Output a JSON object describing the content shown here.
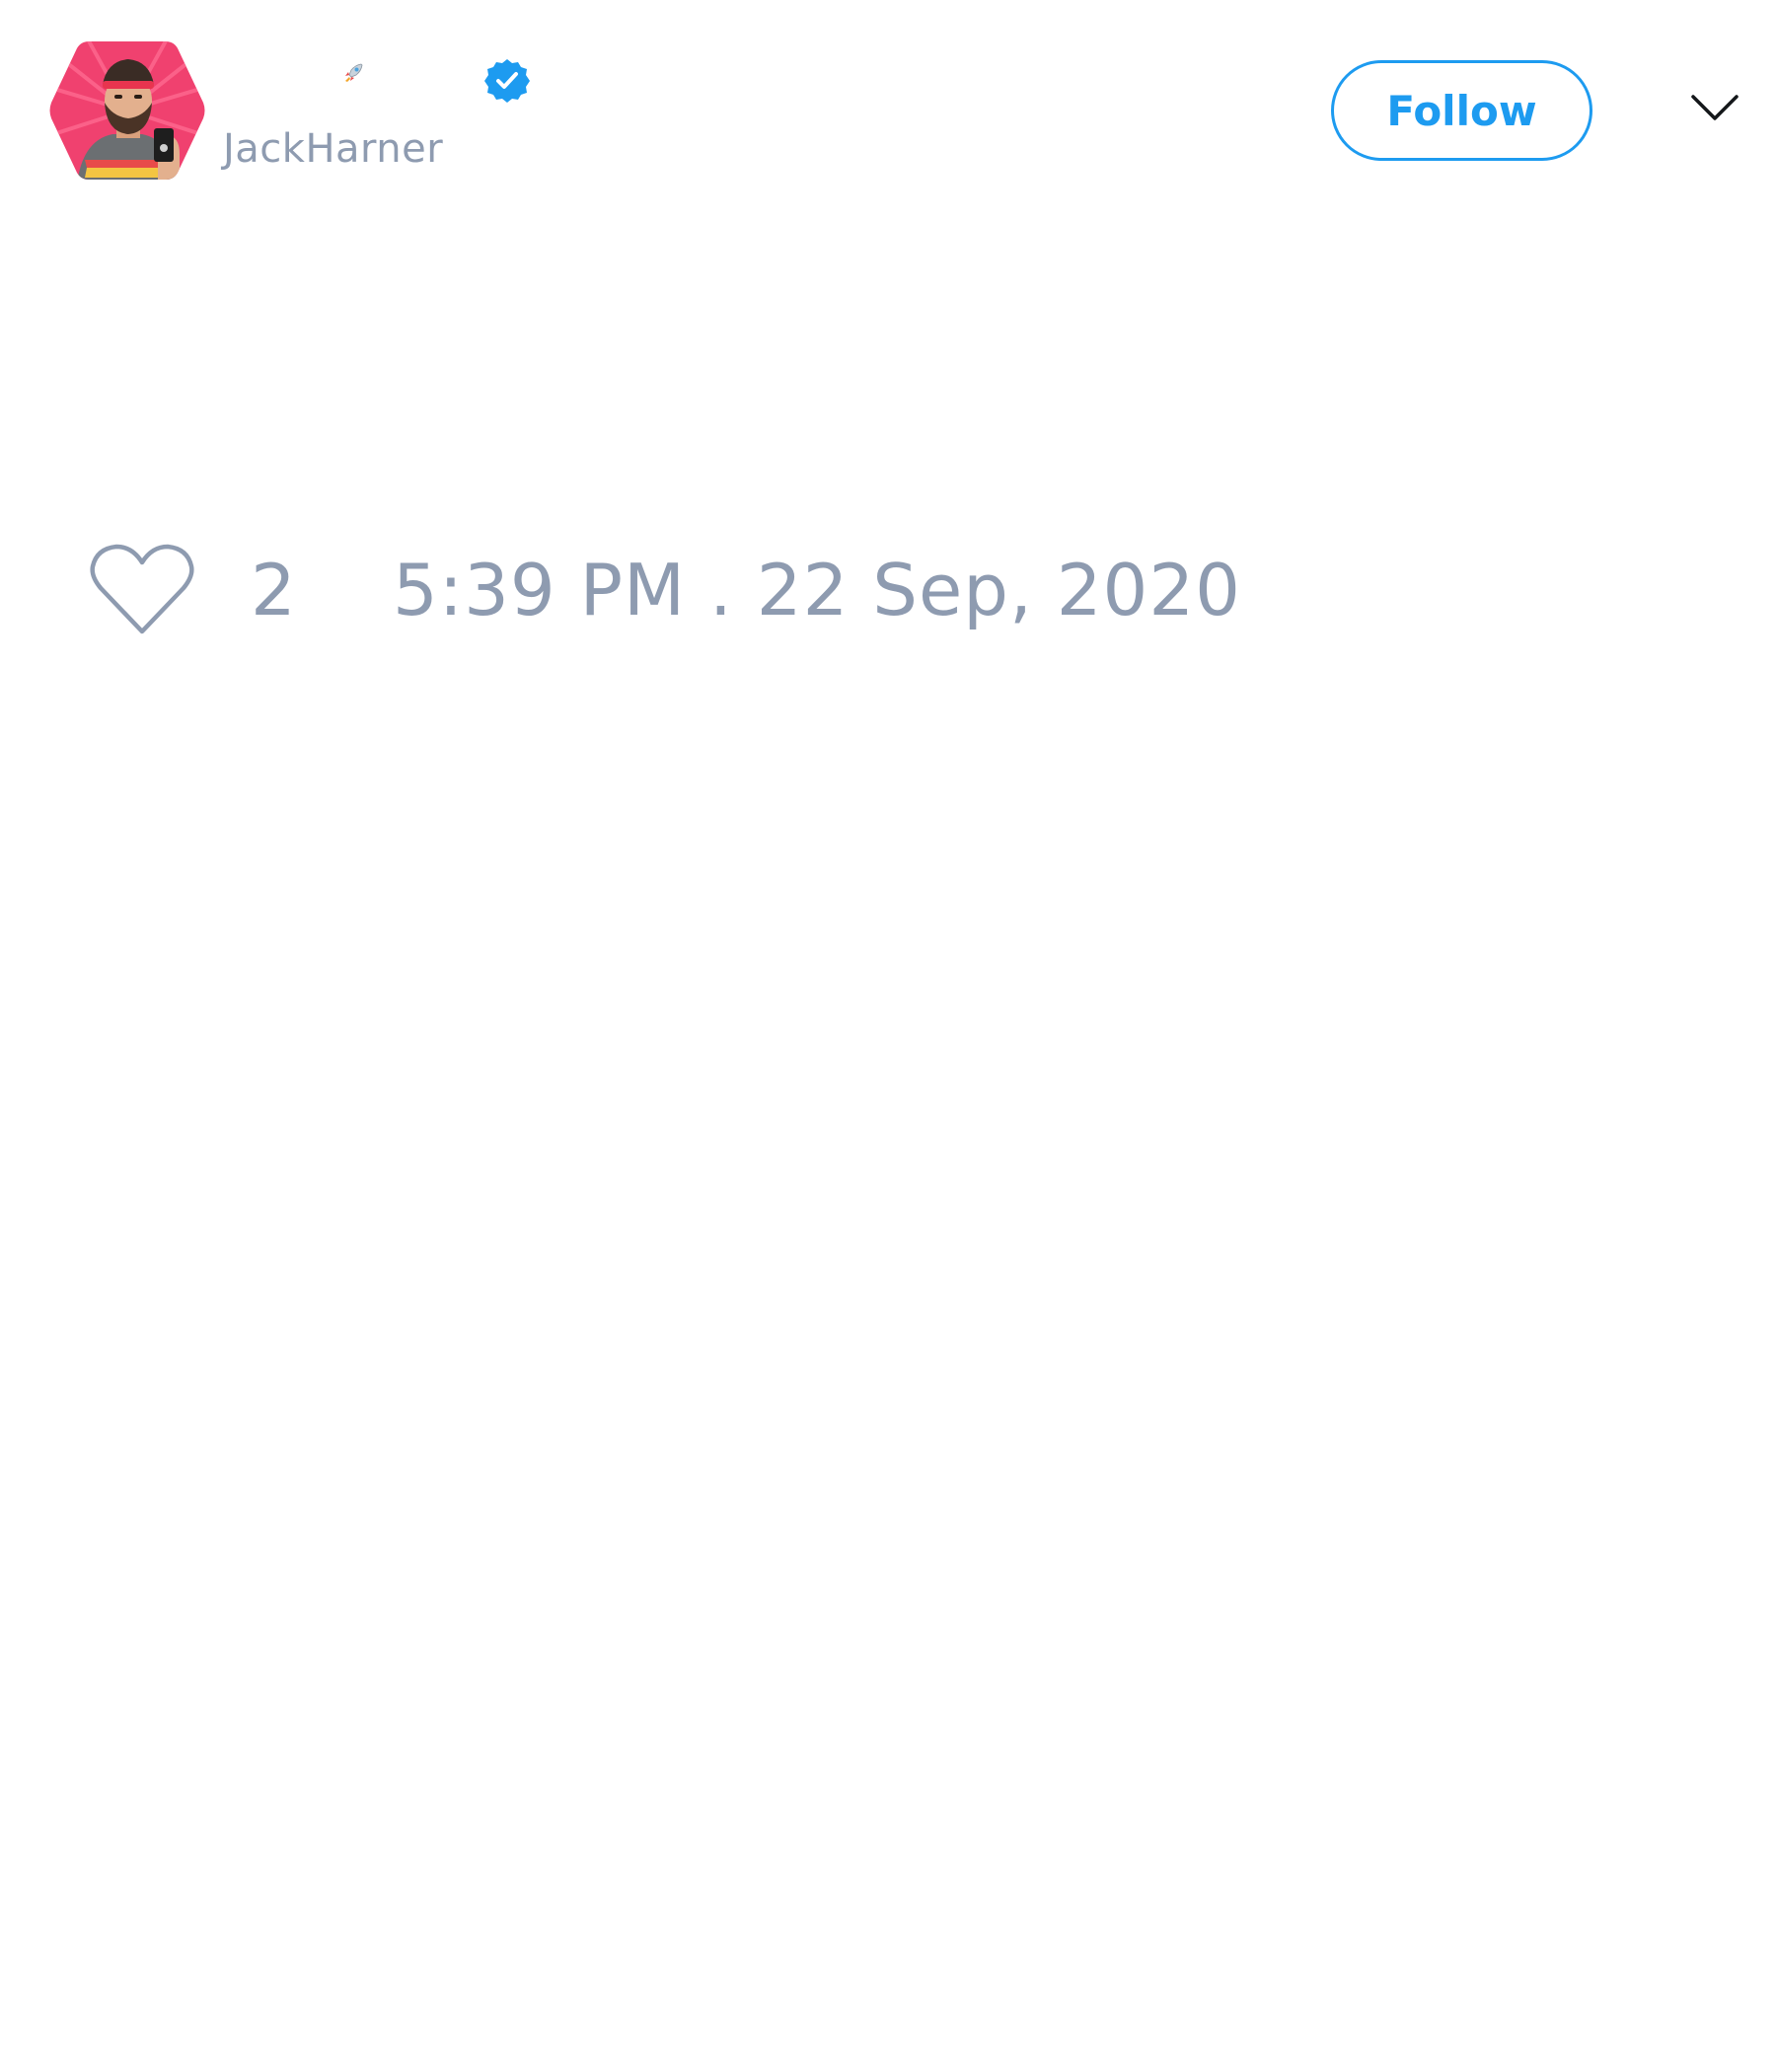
{
  "author": {
    "handle": "JackHarner",
    "verified": true,
    "avatar_icon": "profile-photo-hexagon",
    "name_emoji_icon": "rocket-icon"
  },
  "header": {
    "follow_label": "Follow",
    "menu_icon": "chevron-down-icon"
  },
  "tweet": {
    "like_count": "2",
    "timestamp": "5:39 PM . 22 Sep, 2020"
  },
  "colors": {
    "accent": "#1d9bf0",
    "muted_text": "#8e9bb0",
    "avatar_background": "#f0416f"
  }
}
